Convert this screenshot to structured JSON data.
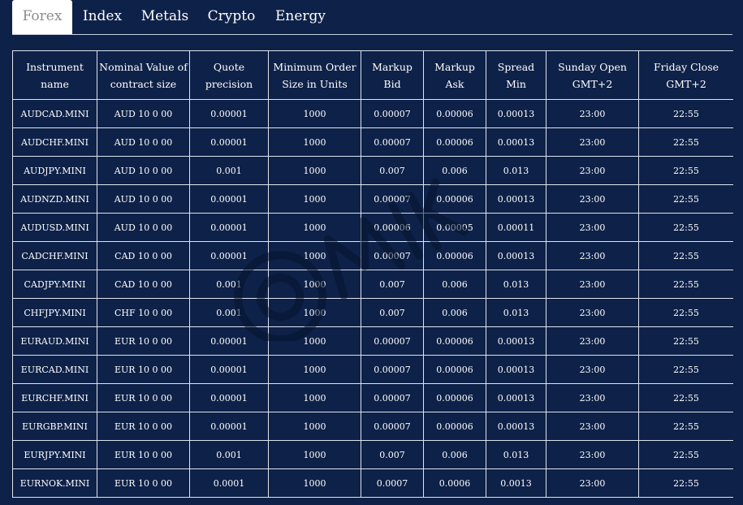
{
  "tabs": [
    {
      "label": "Forex",
      "active": true
    },
    {
      "label": "Index",
      "active": false
    },
    {
      "label": "Metals",
      "active": false
    },
    {
      "label": "Crypto",
      "active": false
    },
    {
      "label": "Energy",
      "active": false
    }
  ],
  "table": {
    "headers": [
      [
        "Instrument name",
        ""
      ],
      [
        "Nominal Value of",
        "contract size"
      ],
      [
        "Quote precision",
        ""
      ],
      [
        "Minimum Order",
        "Size in Units"
      ],
      [
        "Markup Bid",
        ""
      ],
      [
        "Markup Ask",
        ""
      ],
      [
        "Spread Min",
        ""
      ],
      [
        "Sunday Open",
        "GMT+2"
      ],
      [
        "Friday Close",
        "GMT+2"
      ]
    ],
    "rows": [
      [
        "AUDCAD.MINI",
        "AUD 10 0 00",
        "0.00001",
        "1000",
        "0.00007",
        "0.00006",
        "0.00013",
        "23:00",
        "22:55"
      ],
      [
        "AUDCHF.MINI",
        "AUD 10 0 00",
        "0.00001",
        "1000",
        "0.00007",
        "0.00006",
        "0.00013",
        "23:00",
        "22:55"
      ],
      [
        "AUDJPY.MINI",
        "AUD 10 0 00",
        "0.001",
        "1000",
        "0.007",
        "0.006",
        "0.013",
        "23:00",
        "22:55"
      ],
      [
        "AUDNZD.MINI",
        "AUD 10 0 00",
        "0.00001",
        "1000",
        "0.00007",
        "0.00006",
        "0.00013",
        "23:00",
        "22:55"
      ],
      [
        "AUDUSD.MINI",
        "AUD 10 0 00",
        "0.00001",
        "1000",
        "0.00006",
        "0.00005",
        "0.00011",
        "23:00",
        "22:55"
      ],
      [
        "CADCHF.MINI",
        "CAD 10 0 00",
        "0.00001",
        "1000",
        "0.00007",
        "0.00006",
        "0.00013",
        "23:00",
        "22:55"
      ],
      [
        "CADJPY.MINI",
        "CAD 10 0 00",
        "0.001",
        "1000",
        "0.007",
        "0.006",
        "0.013",
        "23:00",
        "22:55"
      ],
      [
        "CHFJPY.MINI",
        "CHF 10 0 00",
        "0.001",
        "1000",
        "0.007",
        "0.006",
        "0.013",
        "23:00",
        "22:55"
      ],
      [
        "EURAUD.MINI",
        "EUR 10 0 00",
        "0.00001",
        "1000",
        "0.00007",
        "0.00006",
        "0.00013",
        "23:00",
        "22:55"
      ],
      [
        "EURCAD.MINI",
        "EUR 10 0 00",
        "0.00001",
        "1000",
        "0.00007",
        "0.00006",
        "0.00013",
        "23:00",
        "22:55"
      ],
      [
        "EURCHF.MINI",
        "EUR 10 0 00",
        "0.00001",
        "1000",
        "0.00007",
        "0.00006",
        "0.00013",
        "23:00",
        "22:55"
      ],
      [
        "EURGBP.MINI",
        "EUR 10 0 00",
        "0.00001",
        "1000",
        "0.00007",
        "0.00006",
        "0.00013",
        "23:00",
        "22:55"
      ],
      [
        "EURJPY.MINI",
        "EUR 10 0 00",
        "0.001",
        "1000",
        "0.007",
        "0.006",
        "0.013",
        "23:00",
        "22:55"
      ],
      [
        "EURNOK.MINI",
        "EUR 10 0 00",
        "0.0001",
        "1000",
        "0.0007",
        "0.0006",
        "0.0013",
        "23:00",
        "22:55"
      ]
    ]
  },
  "colors": {
    "background": "#0e2148",
    "active_tab_bg": "#ffffff",
    "active_tab_text": "#8c8c8c",
    "border": "#dfe4ee"
  },
  "watermark": {
    "icon": "watermark-logo-icon"
  }
}
